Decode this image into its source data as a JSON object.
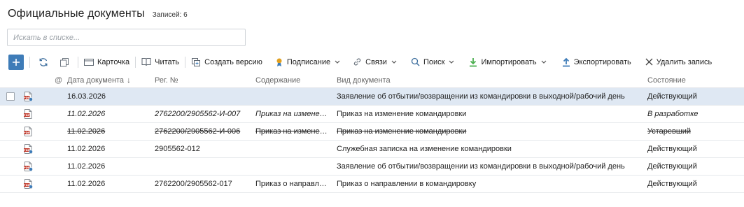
{
  "header": {
    "title": "Официальные документы",
    "record_count": "Записей: 6"
  },
  "search": {
    "placeholder": "Искать в списке..."
  },
  "toolbar": {
    "card": "Карточка",
    "read": "Читать",
    "create_version": "Создать версию",
    "signing": "Подписание",
    "links": "Связи",
    "search": "Поиск",
    "import": "Импортировать",
    "export": "Экспортировать",
    "delete": "Удалить запись"
  },
  "colors": {
    "accent": "#3e7cb8",
    "selected_row": "#dfe8f3",
    "pdf_icon": "#c0392b",
    "import_icon": "#4caf50",
    "export_icon": "#3e7cb8",
    "sign_icon": "#e0a020"
  },
  "columns": {
    "at": "@",
    "date": "Дата документа",
    "reg": "Рег. №",
    "content": "Содержание",
    "type": "Вид документа",
    "state": "Состояние"
  },
  "rows": [
    {
      "icon": "pdf-stamp-icon",
      "date": "16.03.2026",
      "reg": "",
      "content": "",
      "type": "Заявление об отбытии/возвращении из командировки в выходной/рабочий день",
      "state": "Действующий",
      "style": "normal",
      "selected": true
    },
    {
      "icon": "pdf-icon",
      "date": "11.02.2026",
      "reg": "2762200/2905562-И-007",
      "content": "Приказ на изменение командировки",
      "type": "Приказ на изменение командировки",
      "state": "В разработке",
      "style": "italic",
      "selected": false
    },
    {
      "icon": "pdf-icon",
      "date": "11.02.2026",
      "reg": "2762200/2905562-И-006",
      "content": "Приказ на изменение командировки",
      "type": "Приказ на изменение командировки",
      "state": "Устаревший",
      "style": "struck",
      "selected": false
    },
    {
      "icon": "pdf-stamp-icon",
      "date": "11.02.2026",
      "reg": "2905562-012",
      "content": "",
      "type": "Служебная записка на изменение командировки",
      "state": "Действующий",
      "style": "normal",
      "selected": false
    },
    {
      "icon": "pdf-stamp-icon",
      "date": "11.02.2026",
      "reg": "",
      "content": "",
      "type": "Заявление об отбытии/возвращении из командировки в выходной/рабочий день",
      "state": "Действующий",
      "style": "normal",
      "selected": false
    },
    {
      "icon": "pdf-stamp-icon",
      "date": "11.02.2026",
      "reg": "2762200/2905562-017",
      "content": "Приказ о направлении в командировку",
      "type": "Приказ о направлении в командировку",
      "state": "Действующий",
      "style": "normal",
      "selected": false
    }
  ]
}
